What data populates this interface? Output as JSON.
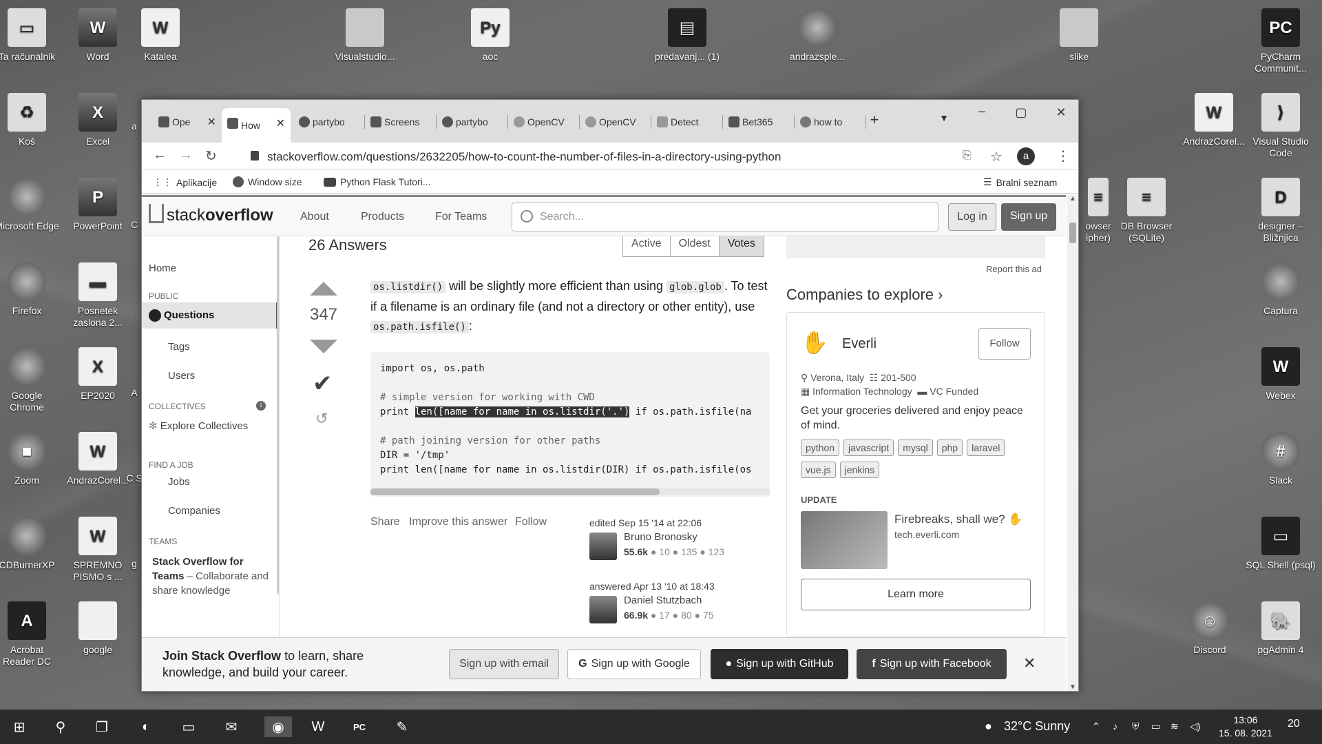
{
  "desktop": {
    "left_col1": [
      "Ta računalnik",
      "Koš",
      "Microsoft Edge",
      "Firefox",
      "Google Chrome",
      "Zoom",
      "CDBurnerXP",
      "Acrobat Reader DC"
    ],
    "left_col2": [
      "Word",
      "Excel",
      "PowerPoint",
      "Posnetek zaslona 2...",
      "EP2020",
      "AndrazCorel...",
      "SPREMNO PISMO s ...",
      "google"
    ],
    "left_col3": [
      "a",
      "C",
      "A",
      "C S",
      "g"
    ],
    "top_row": [
      "Katalea",
      "Visualstudio...",
      "aoc",
      "predavanj... (1)",
      "andrazsple...",
      "slike"
    ],
    "right_col1": [
      "AndrazCorel...",
      "owser ipher)",
      "DB Browser (SQLite)",
      "Discord"
    ],
    "right_col2": [
      "PyCharm Communit...",
      "Visual Studio Code",
      "designer – Bližnjica",
      "Captura",
      "Webex",
      "Slack",
      "SQL Shell (psql)",
      "pgAdmin 4"
    ]
  },
  "browser": {
    "tabs": [
      "Ope",
      "How",
      "partybo",
      "Screens",
      "partybo",
      "OpenCV",
      "OpenCV",
      "Detect",
      "Bet365",
      "how to"
    ],
    "new_tab": "+",
    "url": "stackoverflow.com/questions/2632205/how-to-count-the-number-of-files-in-a-directory-using-python",
    "avatar": "a",
    "bookmarks": {
      "apps": "Aplikacije",
      "b1": "Window size",
      "b2": "Python Flask Tutori...",
      "reading": "Bralni seznam"
    }
  },
  "so": {
    "logo_a": "stack",
    "logo_b": "overflow",
    "nav": [
      "About",
      "Products",
      "For Teams"
    ],
    "search_placeholder": "Search...",
    "login": "Log in",
    "signup": "Sign up",
    "left": {
      "home": "Home",
      "public": "PUBLIC",
      "questions": "Questions",
      "tags": "Tags",
      "users": "Users",
      "collectives": "COLLECTIVES",
      "explore": "Explore Collectives",
      "findjob": "FIND A JOB",
      "jobs": "Jobs",
      "companies": "Companies",
      "teams": "TEAMS",
      "teams_title": "Stack Overflow for Teams",
      "teams_text": " – Collaborate and share knowledge"
    },
    "answers_count": "26 Answers",
    "sort": [
      "Active",
      "Oldest",
      "Votes"
    ],
    "votes": "347",
    "answer_text": {
      "p1": " will be slightly more efficient than using ",
      "p2": ". To test if a filename is an ordinary file (and not a directory or other entity), use ",
      "p3": ":",
      "c1": "os.listdir()",
      "c2": "glob.glob",
      "c3": "os.path.isfile()"
    },
    "code": {
      "l1": "import os, os.path",
      "l3": "# simple version for working with CWD",
      "l4a": "print ",
      "l4b": "len([name for name in os.listdir('.')",
      "l4c": " if os.path.isfile(na",
      "l6": "# path joining version for other paths",
      "l7": "DIR = '/tmp'",
      "l8": "print len([name for name in os.listdir(DIR) if os.path.isfile(os"
    },
    "actions": [
      "Share",
      "Improve this answer",
      "Follow"
    ],
    "edited": {
      "label": "edited Sep 15 '14 at 22:06",
      "name": "Bruno Bronosky",
      "rep": "55.6k",
      "b1": "● 10",
      "b2": "● 135",
      "b3": "● 123"
    },
    "answered": {
      "label": "answered Apr 13 '10 at 18:43",
      "name": "Daniel Stutzbach",
      "rep": "66.9k",
      "b1": "● 17",
      "b2": "● 80",
      "b3": "● 75"
    },
    "right": {
      "report": "Report this ad",
      "companies_title": "Companies to explore",
      "company": "Everli",
      "follow": "Follow",
      "location": "Verona, Italy",
      "size": "201-500",
      "industry": "Information Technology",
      "funding": "VC Funded",
      "desc": "Get your groceries delivered and enjoy peace of mind.",
      "tags": [
        "python",
        "javascript",
        "mysql",
        "php",
        "laravel",
        "vue.js",
        "jenkins"
      ],
      "update": "UPDATE",
      "update_title": "Firebreaks, shall we? ✋",
      "update_link": "tech.everli.com",
      "learn": "Learn more"
    },
    "banner": {
      "bold": "Join Stack Overflow",
      "text": " to learn, share knowledge, and build your career.",
      "email": "Sign up with email",
      "google": "Sign up with Google",
      "github": "Sign up with GitHub",
      "facebook": "Sign up with Facebook"
    }
  },
  "taskbar": {
    "weather": "32°C  Sunny",
    "time": "13:06",
    "date": "15. 08. 2021",
    "notif": "20"
  }
}
